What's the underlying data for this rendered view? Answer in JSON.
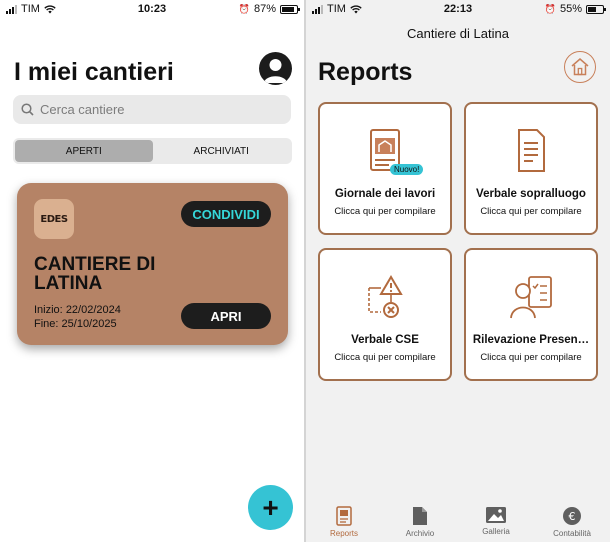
{
  "left": {
    "status": {
      "carrier": "TIM",
      "time": "10:23",
      "battery": "87%",
      "battery_level": 0.87
    },
    "title": "I miei cantieri",
    "search": {
      "placeholder": "Cerca cantiere"
    },
    "segments": [
      {
        "label": "APERTI",
        "active": true
      },
      {
        "label": "ARCHIVIATI",
        "active": false
      }
    ],
    "card": {
      "logo_text": "EDES",
      "share_label": "CONDIVIDI",
      "name": "CANTIERE DI LATINA",
      "start_label": "Inizio:",
      "start_date": "22/02/2024",
      "end_label": "Fine:",
      "end_date": "25/10/2025",
      "open_label": "APRI"
    },
    "fab_label": "+"
  },
  "right": {
    "status": {
      "carrier": "TIM",
      "time": "22:13",
      "battery": "55%",
      "battery_level": 0.55
    },
    "header": "Cantiere di Latina",
    "title": "Reports",
    "tiles": [
      {
        "title": "Giornale dei lavori",
        "subtitle": "Clicca qui per compilare",
        "badge": "Nuovo!",
        "icon": "logbook-icon"
      },
      {
        "title": "Verbale sopralluogo",
        "subtitle": "Clicca qui per compilare",
        "icon": "document-icon"
      },
      {
        "title": "Verbale CSE",
        "subtitle": "Clicca qui per compilare",
        "icon": "warning-flow-icon"
      },
      {
        "title": "Rilevazione Presen…",
        "subtitle": "Clicca qui per compilare",
        "icon": "attendance-icon"
      }
    ],
    "tabbar": [
      {
        "label": "Reports",
        "icon": "reports-icon",
        "active": true
      },
      {
        "label": "Archivio",
        "icon": "file-icon",
        "active": false
      },
      {
        "label": "Galleria",
        "icon": "image-icon",
        "active": false
      },
      {
        "label": "Contabilità",
        "icon": "euro-icon",
        "active": false
      }
    ]
  },
  "colors": {
    "accent": "#b26a3e",
    "card": "#b58366",
    "teal": "#35c3d4",
    "tile_border": "#a2704e"
  }
}
